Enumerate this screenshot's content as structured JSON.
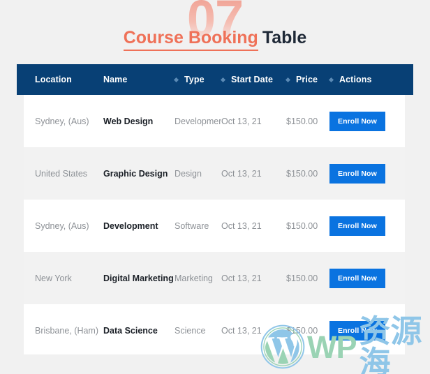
{
  "header": {
    "watermark_number": "07",
    "title_accent": "Course Booking",
    "title_plain": "Table",
    "accent_color": "#ef7158",
    "plain_color": "#1f2937"
  },
  "table": {
    "header_bg": "#084075",
    "separator_color": "#5b8ab5",
    "columns": [
      {
        "label": "Location",
        "separator": false
      },
      {
        "label": "Name",
        "separator": false
      },
      {
        "label": "Type",
        "separator": true
      },
      {
        "label": "Start Date",
        "separator": true
      },
      {
        "label": "Price",
        "separator": true
      },
      {
        "label": "Actions",
        "separator": true
      }
    ],
    "rows": [
      {
        "location": "Sydney, (Aus)",
        "name": "Web Design",
        "type": "Development",
        "start_date": "Oct 13, 21",
        "price": "$150.00",
        "action": "Enroll Now"
      },
      {
        "location": "United States",
        "name": "Graphic Design",
        "type": "Design",
        "start_date": "Oct 13, 21",
        "price": "$150.00",
        "action": "Enroll Now"
      },
      {
        "location": "Sydney, (Aus)",
        "name": "Development",
        "type": "Software",
        "start_date": "Oct 13, 21",
        "price": "$150.00",
        "action": "Enroll Now"
      },
      {
        "location": "New York",
        "name": "Digital Marketing",
        "type": "Marketing",
        "start_date": "Oct 13, 21",
        "price": "$150.00",
        "action": "Enroll Now"
      },
      {
        "location": "Brisbane, (Ham)",
        "name": "Data Science",
        "type": "Science",
        "start_date": "Oct 13, 21",
        "price": "$150.00",
        "action": "Enroll Now"
      }
    ],
    "button_color": "#0a73e0"
  },
  "watermark": {
    "logo_icon": "wordpress-icon",
    "text_latin": "WP",
    "text_cjk": "资源海",
    "latin_color": "#9ad3b4",
    "cjk_color": "#8fc6e8"
  }
}
